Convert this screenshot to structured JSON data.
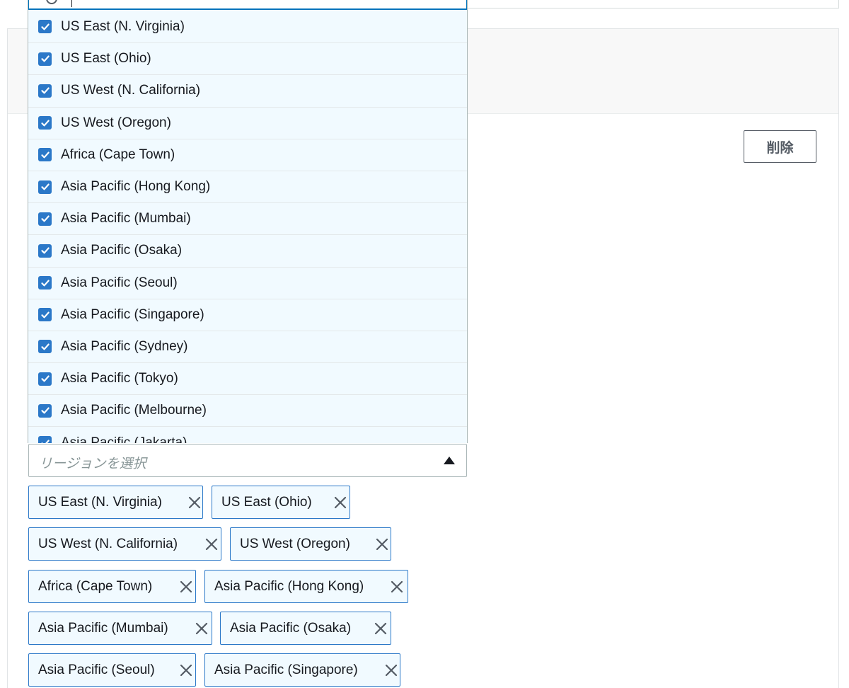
{
  "dropdown": {
    "options": [
      {
        "label": "US East (N. Virginia)",
        "checked": true
      },
      {
        "label": "US East (Ohio)",
        "checked": true
      },
      {
        "label": "US West (N. California)",
        "checked": true
      },
      {
        "label": "US West (Oregon)",
        "checked": true
      },
      {
        "label": "Africa (Cape Town)",
        "checked": true
      },
      {
        "label": "Asia Pacific (Hong Kong)",
        "checked": true
      },
      {
        "label": "Asia Pacific (Mumbai)",
        "checked": true
      },
      {
        "label": "Asia Pacific (Osaka)",
        "checked": true
      },
      {
        "label": "Asia Pacific (Seoul)",
        "checked": true
      },
      {
        "label": "Asia Pacific (Singapore)",
        "checked": true
      },
      {
        "label": "Asia Pacific (Sydney)",
        "checked": true
      },
      {
        "label": "Asia Pacific (Tokyo)",
        "checked": true
      },
      {
        "label": "Asia Pacific (Melbourne)",
        "checked": true
      },
      {
        "label": "Asia Pacific (Jakarta)",
        "checked": true
      }
    ]
  },
  "actions": {
    "delete_label": "削除"
  },
  "region_select": {
    "placeholder": "リージョンを選択"
  },
  "selected_tokens": [
    "US East (N. Virginia)",
    "US East (Ohio)",
    "US West (N. California)",
    "US West (Oregon)",
    "Africa (Cape Town)",
    "Asia Pacific (Hong Kong)",
    "Asia Pacific (Mumbai)",
    "Asia Pacific (Osaka)",
    "Asia Pacific (Seoul)",
    "Asia Pacific (Singapore)"
  ],
  "colors": {
    "accent": "#2b78c8",
    "focus_border": "#0073bb",
    "selected_background": "#f1faff"
  },
  "icons": {
    "checkbox": "check-icon",
    "remove": "close-icon",
    "expand": "caret-up-icon"
  }
}
